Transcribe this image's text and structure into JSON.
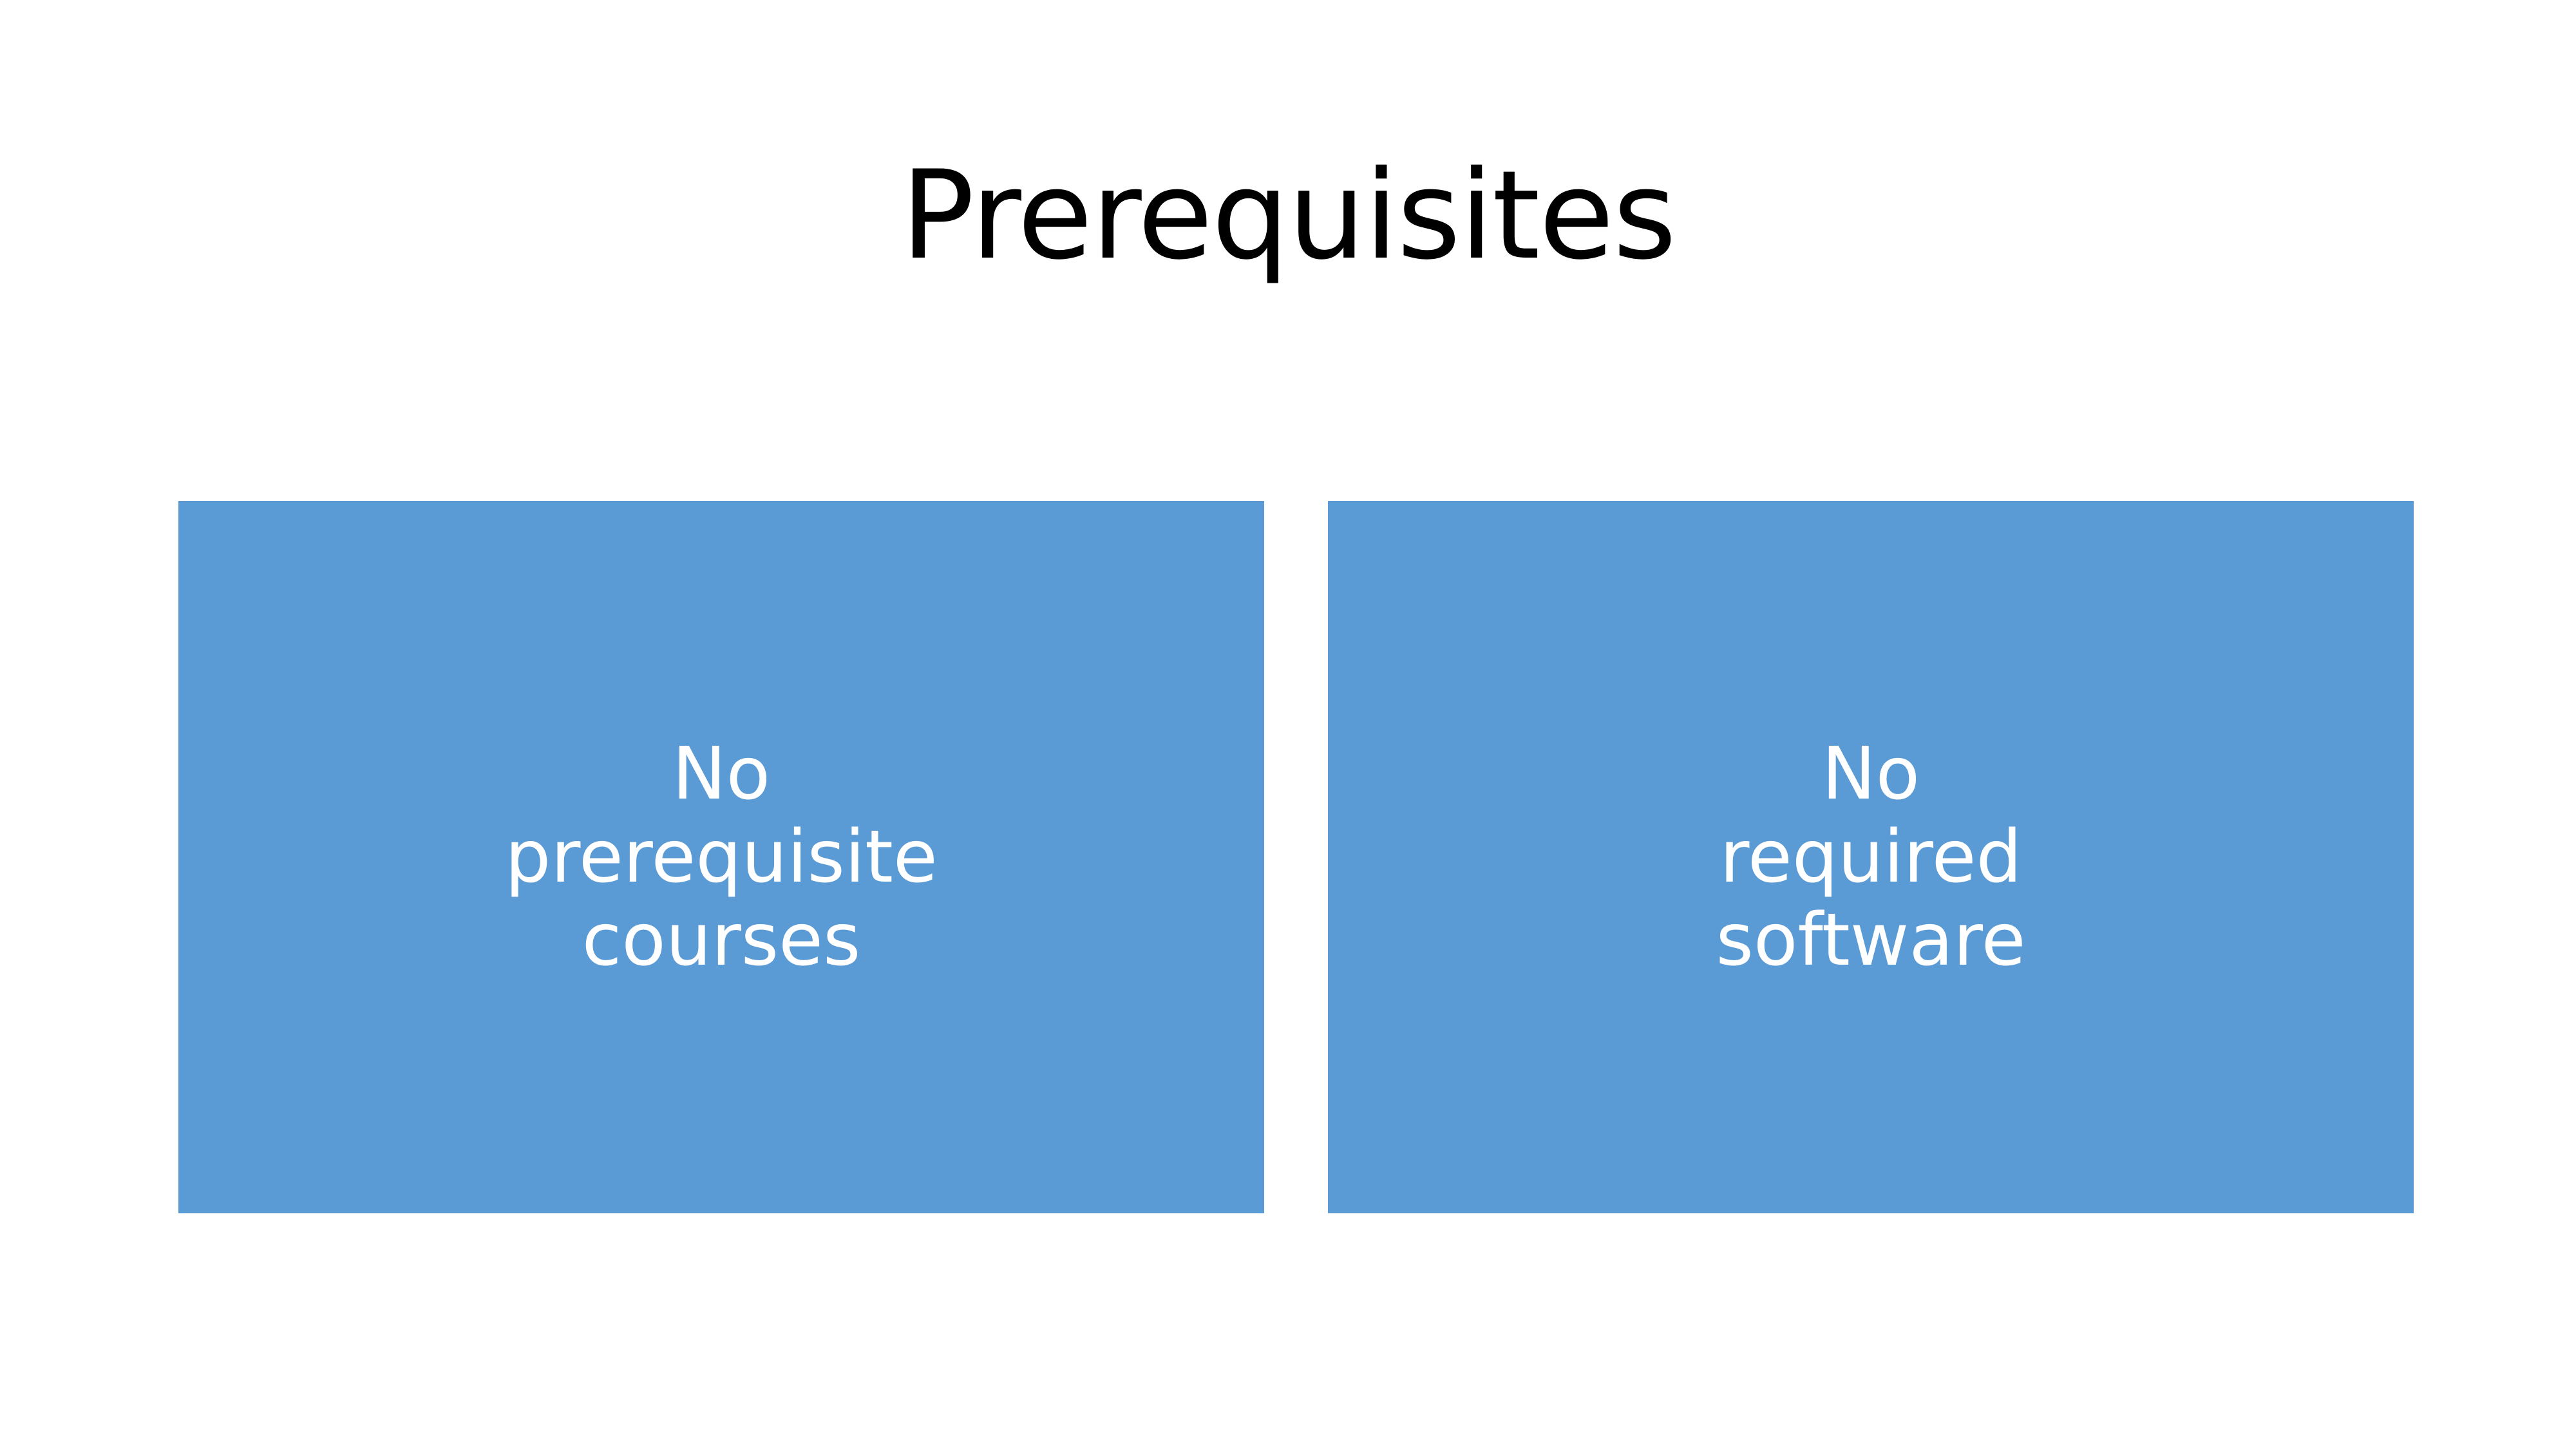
{
  "slide": {
    "title": "Prerequisites",
    "accent_color": "#5b9bd5",
    "boxes": [
      {
        "text": "No\nprerequisite\ncourses"
      },
      {
        "text": "No\nrequired\nsoftware"
      }
    ]
  }
}
